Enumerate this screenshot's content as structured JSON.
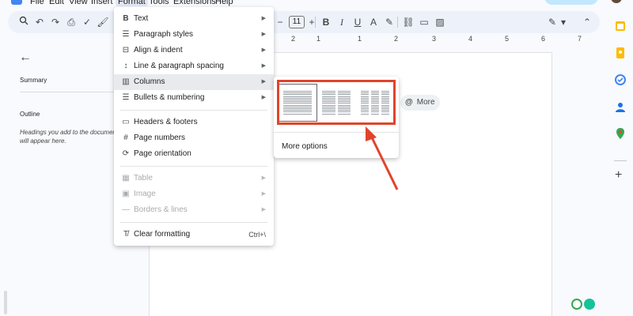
{
  "menubar": {
    "items": [
      "File",
      "Edit",
      "View",
      "Insert",
      "Format",
      "Tools",
      "Extensions",
      "Help"
    ],
    "active": "Format"
  },
  "toolbar": {
    "font_size": "11",
    "bold_label": "B",
    "italic_label": "I",
    "underline_label": "U"
  },
  "ruler": {
    "numbers": [
      "2",
      "1",
      "1",
      "2",
      "3",
      "4",
      "5",
      "6",
      "7"
    ]
  },
  "outline": {
    "summary_label": "Summary",
    "outline_label": "Outline",
    "hint": "Headings you add to the document will appear here."
  },
  "format_menu": {
    "items": [
      {
        "label": "Text",
        "icon": "B",
        "submenu": true
      },
      {
        "label": "Paragraph styles",
        "icon": "☰",
        "submenu": true
      },
      {
        "label": "Align & indent",
        "icon": "⊟",
        "submenu": true
      },
      {
        "label": "Line & paragraph spacing",
        "icon": "↕",
        "submenu": true
      },
      {
        "label": "Columns",
        "icon": "▥",
        "submenu": true
      },
      {
        "label": "Bullets & numbering",
        "icon": "☰",
        "submenu": true
      },
      {
        "label": "Headers & footers",
        "icon": "▭",
        "submenu": false
      },
      {
        "label": "Page numbers",
        "icon": "#",
        "submenu": false
      },
      {
        "label": "Page orientation",
        "icon": "⟳",
        "submenu": false
      },
      {
        "label": "Table",
        "icon": "▦",
        "submenu": true
      },
      {
        "label": "Image",
        "icon": "▣",
        "submenu": true
      },
      {
        "label": "Borders & lines",
        "icon": "—",
        "submenu": true
      },
      {
        "label": "Clear formatting",
        "icon": "T̸",
        "submenu": false,
        "shortcut": "Ctrl+\\"
      }
    ]
  },
  "columns_submenu": {
    "options": [
      "one-column",
      "two-column",
      "three-column"
    ],
    "more_options": "More options"
  },
  "more_chip": {
    "label": "More",
    "icon": "@"
  },
  "colors": {
    "highlight": "#e0442b",
    "accent": "#4285f4",
    "menu_hover": "#e8eaed"
  }
}
